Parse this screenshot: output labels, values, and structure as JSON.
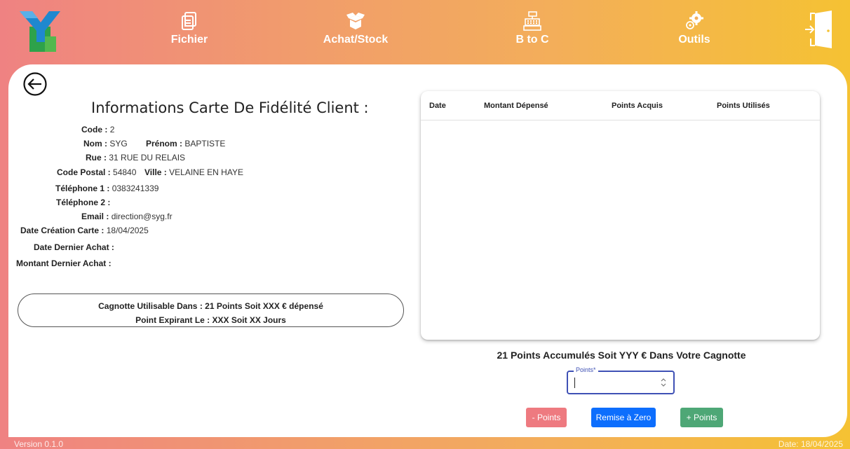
{
  "nav": {
    "items": [
      {
        "label": "Fichier",
        "icon": "file-icon"
      },
      {
        "label": "Achat/Stock",
        "icon": "box-icon"
      },
      {
        "label": "B to C",
        "icon": "cash-register-icon"
      },
      {
        "label": "Outils",
        "icon": "gears-icon"
      }
    ],
    "exit_icon": "exit-door-icon",
    "logo_letters": "SYG"
  },
  "client": {
    "title": "Informations Carte De Fidélité Client :",
    "code_label": "Code :",
    "code": "2",
    "nom_label": "Nom :",
    "nom": "SYG",
    "prenom_label": "Prénom :",
    "prenom": "BAPTISTE",
    "rue_label": "Rue :",
    "rue": "31 RUE DU RELAIS",
    "cp_label": "Code Postal :",
    "cp": "54840",
    "ville_label": "Ville :",
    "ville": "VELAINE EN HAYE",
    "tel1_label": "Téléphone 1 :",
    "tel1": "0383241339",
    "tel2_label": "Téléphone 2 :",
    "tel2": "",
    "email_label": "Email :",
    "email": "direction@syg.fr",
    "creation_label": "Date Création Carte :",
    "creation": "18/04/2025",
    "dernier_achat_label": "Date Dernier Achat :",
    "dernier_achat": "",
    "montant_label": "Montant Dernier Achat :",
    "montant": ""
  },
  "cagnotte": {
    "line1": "Cagnotte Utilisable Dans : 21 Points Soit XXX € dépensé",
    "line2": "Point Expirant Le : XXX Soit XX Jours"
  },
  "table": {
    "columns": [
      "Date",
      "Montant Dépensé",
      "Points Acquis",
      "Points Utilisés"
    ],
    "rows": []
  },
  "points": {
    "summary": "21 Points Accumulés Soit YYY € Dans Votre Cagnotte",
    "field_label": "Points*",
    "field_value": ""
  },
  "buttons": {
    "minus": "- Points",
    "reset": "Remise à Zero",
    "plus": "+ Points"
  },
  "footer": {
    "version": "Version 0.1.0",
    "date": "Date: 18/04/2025"
  },
  "colors": {
    "accent": "#3f51b5",
    "minus_btn": "#ee7a80",
    "reset_btn": "#0d6efd",
    "plus_btn": "#4ea776"
  }
}
